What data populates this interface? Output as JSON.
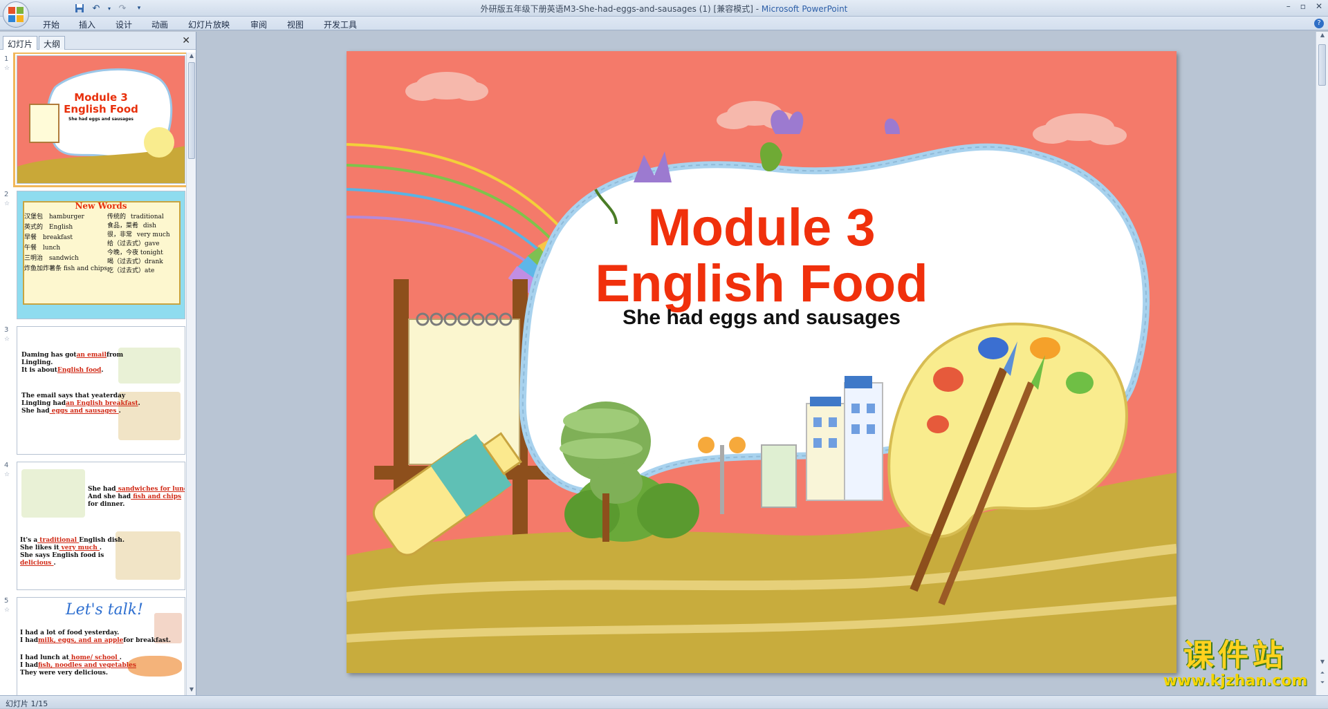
{
  "window": {
    "title_doc": "外研版五年级下册英语M3-She-had-eggs-and-sausages (1) [兼容模式] - ",
    "title_app": "Microsoft PowerPoint"
  },
  "ribbon": {
    "tabs": [
      "开始",
      "插入",
      "设计",
      "动画",
      "幻灯片放映",
      "审阅",
      "视图",
      "开发工具"
    ]
  },
  "pane": {
    "tab_slides": "幻灯片",
    "tab_outline": "大纲",
    "close": "✕"
  },
  "thumbnails": [
    {
      "num": "1",
      "title": "Module 3",
      "subtitle": "English Food",
      "caption": "She had eggs and sausages"
    },
    {
      "num": "2",
      "heading": "New Words",
      "left_col": [
        [
          "汉堡包",
          "hamburger"
        ],
        [
          "英式的",
          "English"
        ],
        [
          "早餐",
          "breakfast"
        ],
        [
          "午餐",
          "lunch"
        ],
        [
          "三明治",
          "sandwich"
        ],
        [
          "炸鱼加炸薯条",
          "fish and chips"
        ]
      ],
      "right_col": [
        [
          "传统的",
          "traditional"
        ],
        [
          "食品，菜肴",
          "dish"
        ],
        [
          "很，非常",
          "very much"
        ],
        [
          "给（过去式）",
          "gave"
        ],
        [
          "今晚，今夜",
          "tonight"
        ],
        [
          "喝（过去式）",
          "drank"
        ],
        [
          "吃（过去式）",
          "ate"
        ]
      ]
    },
    {
      "num": "3",
      "line1a": "Daming has got",
      "line1b": "an email",
      "line1c": "from",
      "line2": "Lingling.",
      "line3a": "It is about",
      "line3b": "English food",
      "line4": "The email says that yeaterday",
      "line5a": "Lingling had",
      "line5b": "an English breakfast",
      "line6a": "She had",
      "line6b": " eggs and sausages "
    },
    {
      "num": "4",
      "l1a": "She had",
      "l1b": " sandwiches for lunch",
      "l2a": "And she had",
      "l2b": " fish and chips ",
      "l3": "for dinner.",
      "l4a": "It's a",
      "l4b": " traditional ",
      "l4c": "English dish.",
      "l5a": "She likes it",
      "l5b": "  very much  ",
      "l6": "She says English food is",
      "l7": " delicious "
    },
    {
      "num": "5",
      "heading": "Let's talk!",
      "l1": "I had a lot of food yesterday.",
      "l2a": "I had",
      "l2b": "milk, eggs, and an apple",
      "l2c": "for breakfast.",
      "l3a": "I had lunch at",
      "l3b": " home/ school ",
      "l4a": "I had",
      "l4b": "fish, noodles and vegetables",
      "l5": "They were very delicious."
    }
  ],
  "slide": {
    "title_line1": "Module 3",
    "title_line2": "English Food",
    "subtitle": "She had eggs and sausages"
  },
  "status": {
    "slide_counter": "幻灯片 1/15"
  },
  "watermark": {
    "cn": "课件站",
    "url": "www.kjzhan.com"
  },
  "colors": {
    "slide_bg": "#f47a6a",
    "title_red": "#f0300c",
    "ribbon_bg": "#dbe5f1"
  }
}
